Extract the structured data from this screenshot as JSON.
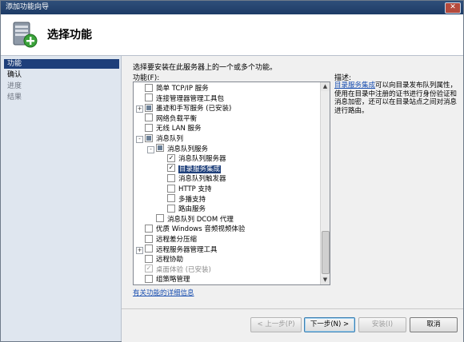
{
  "window": {
    "title": "添加功能向导",
    "close_glyph": "✕"
  },
  "header": {
    "heading": "选择功能",
    "logo_icon": "server-add-icon"
  },
  "nav": {
    "items": [
      {
        "label": "功能",
        "state": "active"
      },
      {
        "label": "确认",
        "state": "normal"
      },
      {
        "label": "进度",
        "state": "disabled"
      },
      {
        "label": "结果",
        "state": "disabled"
      }
    ]
  },
  "content": {
    "instruction": "选择要安装在此服务器上的一个或多个功能。",
    "features_label": "功能(F):",
    "description_title": "描述:",
    "description_link": "目录服务集成",
    "description_text": "可以向目录发布队列属性，使用在目录中注册的证书进行身份验证和消息加密，还可以在目录站点之间对消息进行路由。",
    "more_info_link": "有关功能的详细信息"
  },
  "tree": {
    "rows": [
      {
        "label": "简单 TCP/IP 服务",
        "level": 0,
        "check": "none",
        "expander": ""
      },
      {
        "label": "连接管理器管理工具包",
        "level": 0,
        "check": "none",
        "expander": ""
      },
      {
        "label": "墨迹和手写服务  (已安装)",
        "level": 0,
        "check": "partial",
        "expander": "+"
      },
      {
        "label": "网络负载平衡",
        "level": 0,
        "check": "none",
        "expander": ""
      },
      {
        "label": "无线 LAN 服务",
        "level": 0,
        "check": "none",
        "expander": ""
      },
      {
        "label": "消息队列",
        "level": 0,
        "check": "partial",
        "expander": "-"
      },
      {
        "label": "消息队列服务",
        "level": 1,
        "check": "partial",
        "expander": "-"
      },
      {
        "label": "消息队列服务器",
        "level": 2,
        "check": "checked",
        "expander": ""
      },
      {
        "label": "目录服务集成",
        "level": 2,
        "check": "checked",
        "expander": "",
        "selected": true
      },
      {
        "label": "消息队列触发器",
        "level": 2,
        "check": "none",
        "expander": ""
      },
      {
        "label": "HTTP 支持",
        "level": 2,
        "check": "none",
        "expander": ""
      },
      {
        "label": "多播支持",
        "level": 2,
        "check": "none",
        "expander": ""
      },
      {
        "label": "路由服务",
        "level": 2,
        "check": "none",
        "expander": ""
      },
      {
        "label": "消息队列 DCOM 代理",
        "level": 1,
        "check": "none",
        "expander": ""
      },
      {
        "label": "优质 Windows 音频视频体验",
        "level": 0,
        "check": "none",
        "expander": ""
      },
      {
        "label": "远程差分压缩",
        "level": 0,
        "check": "none",
        "expander": ""
      },
      {
        "label": "远程服务器管理工具",
        "level": 0,
        "check": "none",
        "expander": "+"
      },
      {
        "label": "远程协助",
        "level": 0,
        "check": "none",
        "expander": ""
      },
      {
        "label": "桌面体验  (已安装)",
        "level": 0,
        "check": "disabled",
        "expander": ""
      },
      {
        "label": "组策略管理",
        "level": 0,
        "check": "none",
        "expander": ""
      }
    ],
    "scroll_up": "▲",
    "scroll_down": "▼",
    "check_mark": "✓"
  },
  "footer": {
    "prev": "< 上一步(P)",
    "next": "下一步(N) >",
    "install": "安装(I)",
    "cancel": "取消"
  }
}
